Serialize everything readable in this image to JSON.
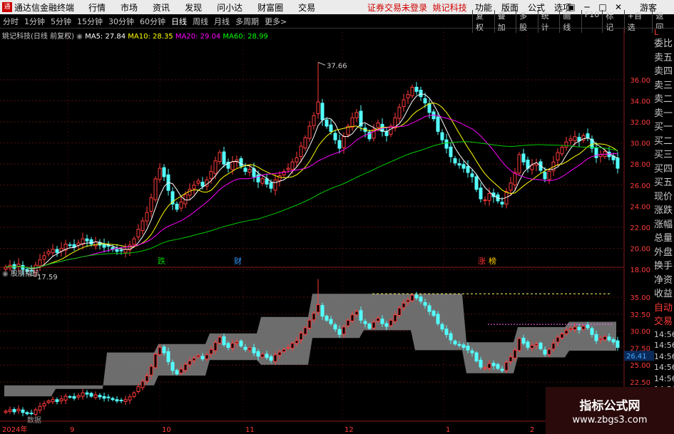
{
  "titlebar": {
    "app_name": "通达信金融终端",
    "menu": [
      "行情",
      "市场",
      "资讯",
      "发现",
      "问小达",
      "财富圈",
      "交易"
    ],
    "warning": "证券交易未登录",
    "stock_name": "姚记科技",
    "right_menu": [
      "功能",
      "版面",
      "公式",
      "选项"
    ],
    "guest": "游客"
  },
  "toolbar": {
    "timeframes": [
      "分时",
      "1分钟",
      "5分钟",
      "15分钟",
      "30分钟",
      "60分钟",
      "日线",
      "周线",
      "月线",
      "多周期"
    ],
    "active": "日线",
    "extra": "更多>",
    "right_buttons": [
      "复权",
      "叠加",
      "多股",
      "统计",
      "画线",
      "F10",
      "标记",
      "+自选",
      "返回"
    ]
  },
  "main_panel": {
    "info_title": "姚记科技(日线 前复权)",
    "ma": [
      {
        "label": "MA5: 27.84",
        "color": "#ffffff"
      },
      {
        "label": "MA10: 28.35",
        "color": "#ffff00"
      },
      {
        "label": "MA20: 29.04",
        "color": "#ff00ff"
      },
      {
        "label": "MA60: 28.99",
        "color": "#00ff00"
      }
    ],
    "high_label": "37.66",
    "low_label": "17.59",
    "y_ticks": [
      "36.00",
      "34.00",
      "32.00",
      "30.00",
      "28.00",
      "26.00",
      "24.00",
      "22.00",
      "20.00",
      "18.00"
    ],
    "markers": [
      {
        "text": "跌",
        "color": "#00cc00"
      },
      {
        "text": "财",
        "color": "#3399ff"
      },
      {
        "text": "涨",
        "color": "#ff3333"
      },
      {
        "text": "榜",
        "color": "#ffcc00"
      }
    ]
  },
  "sub_panel": {
    "title": "股朋指标",
    "y_ticks": [
      "35.00",
      "32.50",
      "30.00",
      "27.50",
      "25.00",
      "22.50"
    ],
    "current_value": "26.41",
    "status_text": "数据"
  },
  "x_axis": {
    "labels": [
      "2024年",
      "9",
      "10",
      "11",
      "12",
      "1",
      "2"
    ]
  },
  "side_panel": {
    "top_flag": "L",
    "items": [
      "委比",
      "卖五",
      "卖四",
      "卖三",
      "卖二",
      "卖一",
      "买一",
      "买二",
      "买三",
      "买四",
      "买五",
      "现价",
      "涨跌",
      "涨幅",
      "总量",
      "外盘",
      "换手",
      "净资",
      "收益"
    ],
    "sections": [
      "自动",
      "交易"
    ],
    "times": [
      "14:56",
      "14:56",
      "14:56",
      "14:56",
      "14:56",
      "14:56",
      "14:56"
    ]
  },
  "watermark": {
    "line1": "指标公式网",
    "line2": "www.zbgs3.com"
  },
  "colors": {
    "up": "#ff3b3b",
    "down": "#54ffff",
    "grid": "#551111",
    "axis_text": "#ff3b3b",
    "band": "#808080"
  },
  "chart_data": {
    "type": "candlestick",
    "price_axis": [
      18,
      37
    ],
    "indicator_axis": [
      22,
      36
    ],
    "close": [
      18.2,
      18.4,
      18.1,
      18.5,
      18.0,
      17.8,
      17.9,
      18.4,
      18.9,
      19.3,
      19.7,
      19.9,
      19.6,
      20.0,
      20.4,
      20.3,
      20.1,
      20.5,
      20.9,
      20.7,
      20.4,
      20.6,
      20.3,
      20.1,
      20.2,
      19.9,
      19.7,
      19.8,
      19.9,
      20.3,
      20.9,
      21.8,
      22.6,
      23.4,
      24.8,
      26.6,
      27.6,
      26.8,
      25.5,
      24.2,
      23.7,
      24.4,
      25.1,
      25.6,
      26.0,
      26.4,
      25.9,
      26.5,
      27.3,
      28.3,
      29.1,
      28.0,
      27.6,
      28.2,
      28.4,
      27.8,
      27.3,
      27.5,
      26.8,
      26.3,
      26.6,
      26.1,
      25.7,
      26.5,
      26.9,
      27.3,
      27.6,
      28.2,
      28.6,
      29.7,
      30.5,
      31.6,
      32.6,
      33.9,
      32.2,
      31.6,
      31.1,
      30.3,
      29.5,
      30.6,
      31.6,
      32.4,
      32.9,
      31.6,
      31.1,
      30.4,
      31.3,
      31.9,
      31.1,
      30.7,
      31.6,
      32.4,
      33.4,
      34.1,
      34.6,
      35.3,
      34.9,
      34.4,
      33.8,
      32.9,
      32.3,
      31.1,
      30.3,
      29.5,
      28.7,
      28.1,
      27.9,
      27.6,
      27.2,
      26.8,
      25.6,
      24.7,
      24.6,
      25.2,
      24.9,
      24.5,
      24.2,
      25.4,
      26.2,
      27.2,
      28.9,
      28.2,
      27.6,
      27.9,
      28.1,
      27.4,
      26.6,
      27.3,
      28.2,
      29.1,
      29.6,
      30.1,
      30.4,
      30.6,
      30.2,
      30.7,
      30.5,
      29.5,
      28.6,
      28.9,
      29.2,
      28.7,
      28.4,
      27.6
    ]
  }
}
